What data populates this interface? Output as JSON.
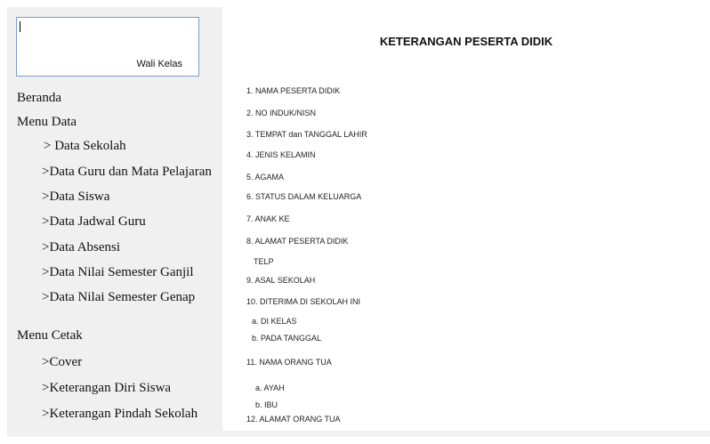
{
  "user_panel": {
    "role_label": "Wali Kelas"
  },
  "sidebar": {
    "beranda": "Beranda",
    "menu_data": "Menu Data",
    "data_items": [
      "> Data Sekolah",
      ">Data Guru dan Mata Pelajaran",
      ">Data Siswa",
      ">Data Jadwal Guru",
      ">Data Absensi",
      ">Data Nilai Semester Ganjil",
      ">Data Nilai Semester Genap"
    ],
    "menu_cetak": "Menu Cetak",
    "cetak_items": [
      ">Cover",
      ">Keterangan Diri Siswa",
      ">Keterangan Pindah Sekolah"
    ]
  },
  "document": {
    "title": "KETERANGAN PESERTA DIDIK",
    "fields": [
      "1. NAMA PESERTA DIDIK",
      "2. NO INDUK/NISN",
      "3. TEMPAT dan TANGGAL LAHIR",
      "4. JENIS KELAMIN",
      "5. AGAMA",
      "6. STATUS DALAM KELUARGA",
      "7. ANAK KE",
      "8. ALAMAT PESERTA DIDIK",
      "TELP",
      "9. ASAL SEKOLAH",
      "10. DITERIMA DI SEKOLAH INI",
      "a. DI KELAS",
      "b. PADA TANGGAL",
      "11. NAMA ORANG TUA",
      "a. AYAH",
      "b. IBU",
      "12. ALAMAT ORANG TUA"
    ]
  }
}
